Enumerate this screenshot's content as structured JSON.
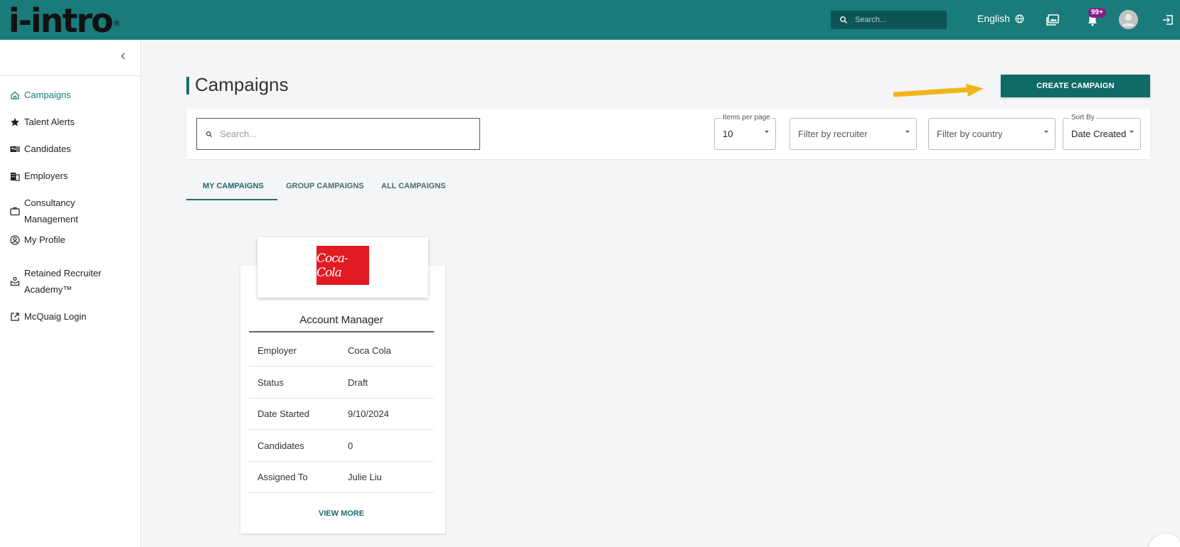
{
  "header": {
    "logo_text": "i-intro",
    "logo_reg": "®",
    "search_placeholder": "Search...",
    "language": "English",
    "notification_count": "99+"
  },
  "sidebar": {
    "items": [
      {
        "label": "Campaigns",
        "icon": "home-icon",
        "active": true
      },
      {
        "label": "Talent Alerts",
        "icon": "star-icon"
      },
      {
        "label": "Candidates",
        "icon": "id-card-icon"
      },
      {
        "label": "Employers",
        "icon": "building-icon"
      },
      {
        "label_line1": "Consultancy",
        "label_line2": "Management",
        "icon": "briefcase-icon"
      },
      {
        "label": "My Profile",
        "icon": "user-circle-icon"
      },
      {
        "label_line1": "Retained Recruiter",
        "label_line2": "Academy™",
        "icon": "academy-icon"
      },
      {
        "label": "McQuaig Login",
        "icon": "external-link-icon"
      }
    ]
  },
  "main": {
    "title": "Campaigns",
    "create_label": "CREATE CAMPAIGN",
    "search_placeholder": "Search...",
    "items_per_page": {
      "legend": "Items per page",
      "value": "10"
    },
    "filter_recruiter": "Filter by recruiter",
    "filter_country": "Filter by country",
    "sort_by": {
      "legend": "Sort By",
      "value": "Date Created (newest)"
    },
    "tabs": [
      "MY CAMPAIGNS",
      "GROUP CAMPAIGNS",
      "ALL CAMPAIGNS"
    ],
    "active_tab": 0
  },
  "campaign_card": {
    "logo_text": "Coca-Cola",
    "title": "Account Manager",
    "rows": [
      {
        "key": "Employer",
        "value": "Coca Cola"
      },
      {
        "key": "Status",
        "value": "Draft"
      },
      {
        "key": "Date Started",
        "value": "9/10/2024"
      },
      {
        "key": "Candidates",
        "value": "0"
      },
      {
        "key": "Assigned To",
        "value": "Julie Liu"
      }
    ],
    "view_more": "VIEW MORE"
  },
  "colors": {
    "brand": "#1a7b7b",
    "button": "#0f6b66",
    "arrow": "#f0b619",
    "badge": "#8a1c8c"
  }
}
